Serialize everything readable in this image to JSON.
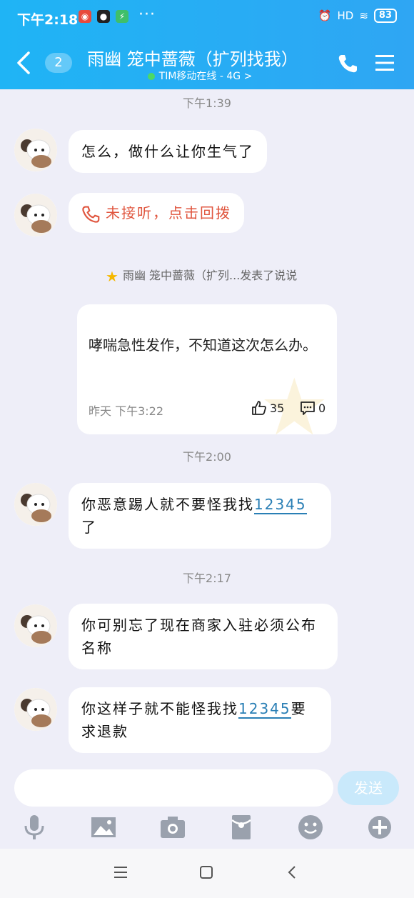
{
  "status_bar": {
    "time": "下午2:18",
    "battery": "83",
    "network": "HD",
    "dots": "···"
  },
  "header": {
    "unread_count": "2",
    "title": "雨幽 笼中蔷薇（扩列找我）",
    "subtitle": "TIM移动在线 - 4G >",
    "back_icon": "back-icon",
    "phone_icon": "phone-icon",
    "menu_icon": "menu-icon"
  },
  "messages": [
    {
      "timestamp": "下午1:39"
    },
    {
      "text": "怎么，做什么让你生气了"
    },
    {
      "missed_call": "未接听，点击回拨"
    },
    {
      "notice": "雨幽 笼中蔷薇（扩列...发表了说说"
    },
    {
      "card": {
        "text": "哮喘急性发作，不知道这次怎么办。",
        "time": "昨天 下午3:22",
        "likes": "35",
        "comments": "0"
      }
    },
    {
      "timestamp": "下午2:00"
    },
    {
      "text_before": "你恶意踢人就不要怪我找",
      "link": "12345",
      "text_after": "了"
    },
    {
      "timestamp": "下午2:17"
    },
    {
      "text": "你可别忘了现在商家入驻必须公布名称"
    },
    {
      "text_before": "你这样子就不能怪我找",
      "link": "12345",
      "text_after": "要求退款"
    }
  ],
  "input": {
    "placeholder": "",
    "send_label": "发送"
  },
  "toolbar": [
    "mic-icon",
    "image-icon",
    "camera-icon",
    "red-packet-icon",
    "emoji-icon",
    "plus-icon"
  ],
  "colors": {
    "header": "#1fb4f5",
    "accent_link": "#2a7fb5",
    "missed_call": "#e0563f",
    "background": "#eeeef8"
  }
}
